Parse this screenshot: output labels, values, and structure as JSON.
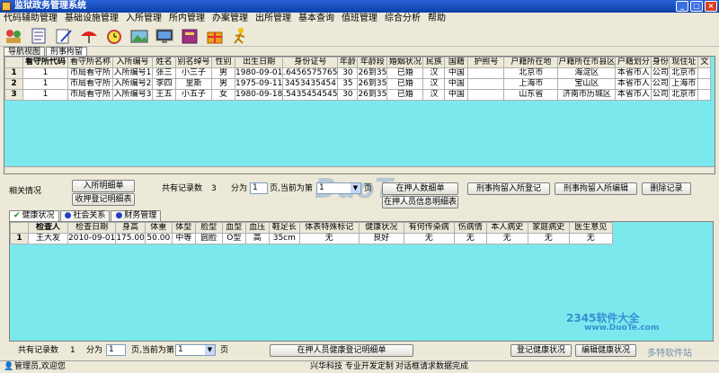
{
  "window": {
    "title": "监狱政务管理系统"
  },
  "menu": [
    "代码辅助管理",
    "基础设施管理",
    "入所管理",
    "所内管理",
    "办案管理",
    "出所管理",
    "基本查询",
    "值班管理",
    "综合分析",
    "帮助"
  ],
  "toolbar_icons": [
    "people-icon",
    "document-icon",
    "edit-icon",
    "umbrella-icon",
    "alarm-clock-icon",
    "image-icon",
    "monitor-icon",
    "book-icon",
    "gift-icon",
    "runner-icon"
  ],
  "tabs": [
    "导航视图",
    "刑事拘留"
  ],
  "table1": {
    "headers": [
      "看守所代码",
      "看守所名称",
      "入所编号",
      "姓名",
      "别名绰号",
      "性别",
      "出生日期",
      "身份证号",
      "年龄",
      "年龄段",
      "婚姻状况",
      "民族",
      "国籍",
      "护照号",
      "户籍所在地",
      "户籍所在市县区",
      "户籍划分",
      "身份",
      "现住址",
      "文"
    ],
    "rows": [
      [
        "1",
        "市局看守所",
        "入所编号1",
        "张三",
        "小三子",
        "男",
        "1980-09-01",
        ".6456575765",
        "30",
        "26到35",
        "已婚",
        "汉",
        "中国",
        "",
        "北京市",
        "海淀区",
        "本省市人",
        "公司",
        "北京市",
        ""
      ],
      [
        "1",
        "市局看守所",
        "入所编号2",
        "李四",
        "里斯",
        "男",
        "1975-09-11",
        "3453435454",
        "35",
        "26到35",
        "已婚",
        "汉",
        "中国",
        "",
        "上海市",
        "宝山区",
        "本省市人",
        "公司",
        "上海市",
        ""
      ],
      [
        "1",
        "市局看守所",
        "入所编号3",
        "王五",
        "小五子",
        "女",
        "1980-09-18",
        ".5435454545",
        "30",
        "26到35",
        "已婚",
        "汉",
        "中国",
        "",
        "山东省",
        "济南市历城区",
        "本省市人",
        "公司",
        "北京市",
        ""
      ]
    ],
    "row_numbers": [
      "1",
      "2",
      "3"
    ]
  },
  "controls1": {
    "related_label": "相关情况",
    "btn_intake_list": "入所明细单",
    "btn_receipt_list": "收押登记明细表",
    "total_label": "共有记录数",
    "total_value": "3",
    "per_label": "分为",
    "pages": "1",
    "page_label": "页,当前为第",
    "current_page": "1",
    "page_suffix": "页",
    "btn_detainee_list": "在押人数细单",
    "btn_detainee_info": "在押人员信息明细表",
    "btn_criminal_register": "刑事拘留入所登记",
    "btn_criminal_edit": "刑事拘留入所编辑",
    "btn_delete": "删除记录"
  },
  "tabs2": [
    "健康状况",
    "社会关系",
    "财务管理"
  ],
  "table2": {
    "headers": [
      "检查人",
      "检查日期",
      "身高",
      "体重",
      "体型",
      "脸型",
      "血型",
      "血压",
      "鞋足长",
      "体表特殊标记",
      "健康状况",
      "有何传染病",
      "伤病情",
      "本人病史",
      "家庭病史",
      "医生意见"
    ],
    "rows": [
      [
        "王大发",
        "2010-09-01",
        "175.00",
        "50.00",
        "中等",
        "圆脸",
        "O型",
        "高",
        "35cm",
        "无",
        "良好",
        "无",
        "无",
        "无",
        "无",
        "无"
      ]
    ],
    "row_numbers": [
      "1"
    ]
  },
  "controls2": {
    "total_label": "共有记录数",
    "total_value": "1",
    "per_label": "分为",
    "pages": "1",
    "page_label": "页,当前为第",
    "current_page": "1",
    "page_suffix": "页",
    "btn_health_list": "在押人员健康登记明细单",
    "btn_health_register": "登记健康状况",
    "btn_health_edit": "编辑健康状况"
  },
  "status": {
    "user": "管理员,欢迎您",
    "company": "兴华科技  专业开发定制",
    "message": "对话框请求数据完成"
  },
  "watermarks": {
    "main": "DuoTe",
    "site": "2345软件大全",
    "url": "www.DuoTe.com",
    "sub": "多特软件站"
  }
}
